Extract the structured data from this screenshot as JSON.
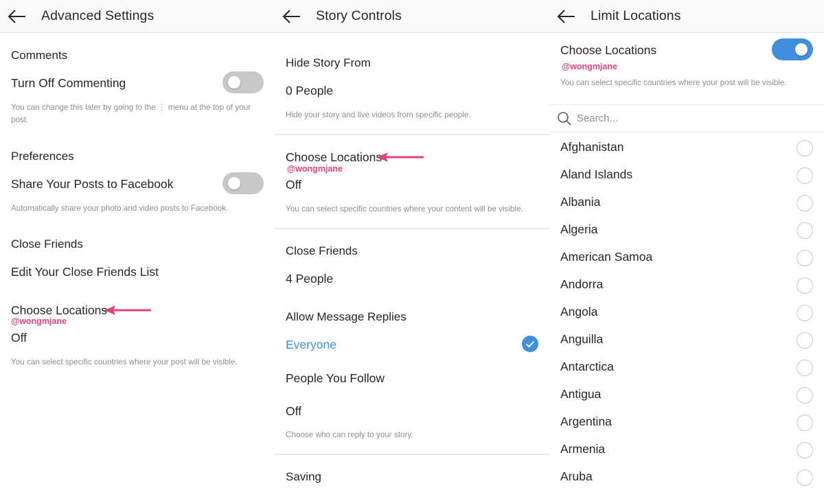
{
  "colors": {
    "accent_blue": "#3f8fdc",
    "annotation_pink": "#e0437b",
    "hint_gray": "#8e8e8e",
    "toggle_off": "#c8c8c8"
  },
  "advanced_settings": {
    "title": "Advanced Settings",
    "comments": {
      "section": "Comments",
      "turn_off_commenting": "Turn Off Commenting",
      "turn_off_commenting_enabled": false,
      "hint_line1": "You can change this later by going to the ⋮ menu at the top of your",
      "hint_line2": "post."
    },
    "preferences": {
      "section": "Preferences",
      "share_to_facebook": "Share Your Posts to Facebook",
      "share_to_facebook_enabled": false,
      "hint": "Automatically share your photo and video posts to Facebook."
    },
    "close_friends": {
      "section": "Close Friends",
      "edit_list": "Edit Your Close Friends List"
    },
    "choose_locations": {
      "label": "Choose Locations",
      "handle": "@wongmjane",
      "value": "Off",
      "hint": "You can select specific countries where your post will be visible."
    }
  },
  "story_controls": {
    "title": "Story Controls",
    "hide_story_from": {
      "section": "Hide Story From",
      "value": "0 People",
      "hint": "Hide your story and live videos from specific people."
    },
    "choose_locations": {
      "label": "Choose Locations",
      "handle": "@wongmjane",
      "value": "Off",
      "hint": "You can select specific countries where your content will be visible."
    },
    "close_friends": {
      "section": "Close Friends",
      "value": "4 People"
    },
    "allow_message_replies": {
      "section": "Allow Message Replies",
      "options": [
        {
          "label": "Everyone",
          "selected": true
        },
        {
          "label": "People You Follow",
          "selected": false
        },
        {
          "label": "Off",
          "selected": false
        }
      ],
      "hint": "Choose who can reply to your story."
    },
    "saving": {
      "section": "Saving"
    }
  },
  "limit_locations": {
    "title": "Limit Locations",
    "choose_locations": {
      "label": "Choose Locations",
      "handle": "@wongmjane",
      "enabled": true,
      "hint": "You can select specific countries where your post will be visible."
    },
    "search": {
      "placeholder": "Search...",
      "value": ""
    },
    "countries": [
      {
        "name": "Afghanistan",
        "selected": false
      },
      {
        "name": "Aland Islands",
        "selected": false
      },
      {
        "name": "Albania",
        "selected": false
      },
      {
        "name": "Algeria",
        "selected": false
      },
      {
        "name": "American Samoa",
        "selected": false
      },
      {
        "name": "Andorra",
        "selected": false
      },
      {
        "name": "Angola",
        "selected": false
      },
      {
        "name": "Anguilla",
        "selected": false
      },
      {
        "name": "Antarctica",
        "selected": false
      },
      {
        "name": "Antigua",
        "selected": false
      },
      {
        "name": "Argentina",
        "selected": false
      },
      {
        "name": "Armenia",
        "selected": false
      },
      {
        "name": "Aruba",
        "selected": false
      }
    ]
  }
}
